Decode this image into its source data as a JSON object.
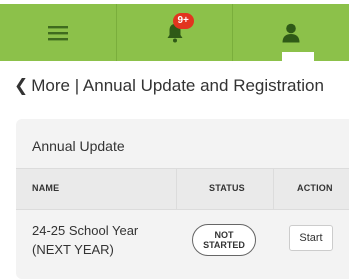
{
  "topbar": {
    "menu_icon": "hamburger-icon",
    "notifications_icon": "bell-icon",
    "notification_badge": "9+",
    "profile_icon": "user-icon",
    "bar_color": "#8cc14a",
    "badge_color": "#e2351f"
  },
  "page": {
    "back_icon": "chevron-left-icon",
    "title": "More | Annual Update and Registration"
  },
  "panel": {
    "title": "Annual Update",
    "columns": [
      "NAME",
      "STATUS",
      "ACTION"
    ],
    "rows": [
      {
        "name_line1": "24-25 School Year",
        "name_line2": "(NEXT YEAR)",
        "status_line1": "NOT",
        "status_line2": "STARTED",
        "action": "Start"
      }
    ]
  }
}
